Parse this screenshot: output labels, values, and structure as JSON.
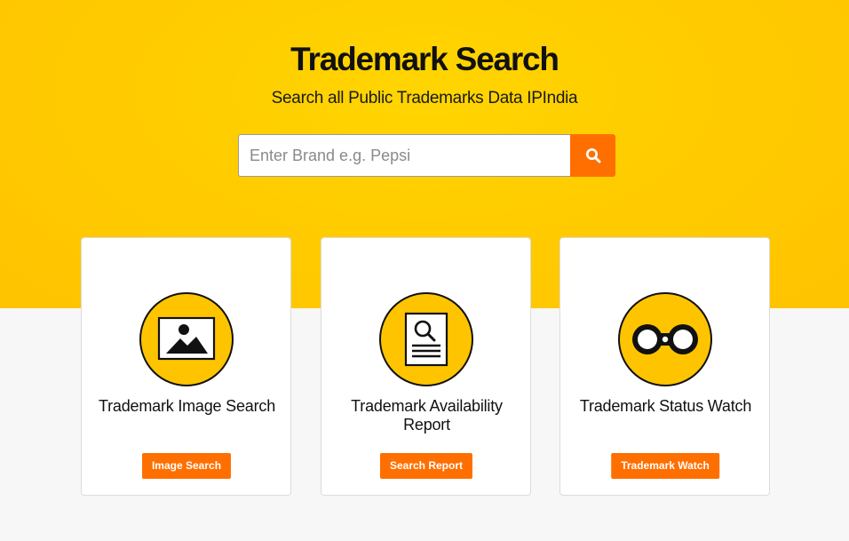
{
  "hero": {
    "title": "Trademark Search",
    "subtitle": "Search all Public Trademarks Data IPIndia"
  },
  "search": {
    "placeholder": "Enter Brand e.g. Pepsi",
    "button_icon": "search-icon"
  },
  "cards": [
    {
      "title": "Trademark Image Search",
      "button_label": "Image Search",
      "icon": "image-icon"
    },
    {
      "title": "Trademark Availability Report",
      "button_label": "Search Report",
      "icon": "document-search-icon"
    },
    {
      "title": "Trademark Status Watch",
      "button_label": "Trademark Watch",
      "icon": "binoculars-icon"
    }
  ],
  "colors": {
    "hero_background": "#ffc800",
    "accent_orange": "#ff6f00",
    "icon_circle": "#ffc400",
    "page_background": "#f7f7f7"
  }
}
